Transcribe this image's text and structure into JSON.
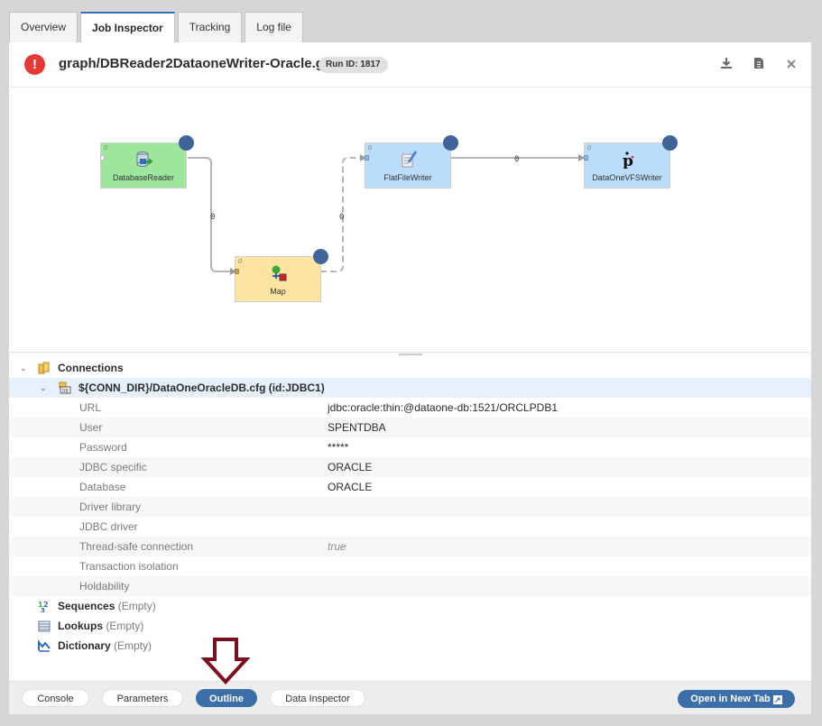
{
  "tabs": [
    "Overview",
    "Job Inspector",
    "Tracking",
    "Log file"
  ],
  "header": {
    "graph_path": "graph/DBReader2DataoneWriter-Oracle.grf",
    "run_id": "Run ID: 1817",
    "error_icon": "!",
    "download_icon": "download-icon",
    "file_icon": "file-icon",
    "close_icon": "close-icon"
  },
  "graph": {
    "nodes": [
      {
        "id": "db",
        "label": "DatabaseReader",
        "port": "0",
        "color": "#9ee59e"
      },
      {
        "id": "map",
        "label": "Map",
        "port": "0",
        "color": "#fde4a1"
      },
      {
        "id": "ff",
        "label": "FlatFileWriter",
        "port": "0",
        "color": "#bcdcfb"
      },
      {
        "id": "vfs",
        "label": "DataOneVFSWriter",
        "port": "0",
        "color": "#bcdcfb"
      }
    ],
    "edges": [
      {
        "from": "db",
        "to": "map",
        "label": "0"
      },
      {
        "from": "map",
        "to": "ff",
        "label": "0"
      },
      {
        "from": "ff",
        "to": "vfs",
        "label": "0"
      }
    ]
  },
  "tree": {
    "connections_label": "Connections",
    "connection": {
      "label": "${CONN_DIR}/DataOneOracleDB.cfg (id:JDBC1)",
      "props": [
        {
          "name": "URL",
          "value": "jdbc:oracle:thin:@dataone-db:1521/ORCLPDB1"
        },
        {
          "name": "User",
          "value": "SPENTDBA"
        },
        {
          "name": "Password",
          "value": "*****"
        },
        {
          "name": "JDBC specific",
          "value": "ORACLE"
        },
        {
          "name": "Database",
          "value": "ORACLE"
        },
        {
          "name": "Driver library",
          "value": ""
        },
        {
          "name": "JDBC driver",
          "value": ""
        },
        {
          "name": "Thread-safe connection",
          "value": "true",
          "muted": true
        },
        {
          "name": "Transaction isolation",
          "value": ""
        },
        {
          "name": "Holdability",
          "value": ""
        }
      ]
    },
    "sequences_label": "Sequences",
    "lookups_label": "Lookups",
    "dictionary_label": "Dictionary",
    "empty_label": "(Empty)"
  },
  "footer": {
    "buttons": [
      "Console",
      "Parameters",
      "Outline",
      "Data Inspector"
    ],
    "active": "Outline",
    "open_new_tab": "Open in New Tab"
  },
  "colors": {
    "accent": "#3c6fa8",
    "error": "#e53935",
    "annotation_arrow": "#7a1020"
  }
}
